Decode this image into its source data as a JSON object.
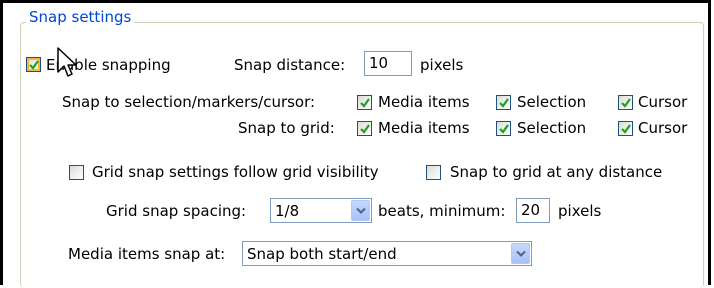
{
  "group": {
    "title": "Snap settings"
  },
  "enable_snapping": {
    "label": "Enable snapping",
    "checked": true
  },
  "snap_distance": {
    "label": "Snap distance:",
    "value": "10",
    "unit": "pixels"
  },
  "snap_to_selection": {
    "label": "Snap to selection/markers/cursor:",
    "options": [
      {
        "label": "Media items",
        "checked": true
      },
      {
        "label": "Selection",
        "checked": true
      },
      {
        "label": "Cursor",
        "checked": true
      }
    ]
  },
  "snap_to_grid": {
    "label": "Snap to grid:",
    "options": [
      {
        "label": "Media items",
        "checked": true
      },
      {
        "label": "Selection",
        "checked": true
      },
      {
        "label": "Cursor",
        "checked": true
      }
    ]
  },
  "grid_follow_visibility": {
    "label": "Grid snap settings follow grid visibility",
    "checked": false
  },
  "grid_any_distance": {
    "label": "Snap to grid at any distance",
    "checked": false
  },
  "grid_spacing": {
    "label": "Grid snap spacing:",
    "value": "1/8",
    "suffix": "beats, minimum:",
    "minimum": "20",
    "unit": "pixels"
  },
  "media_snap": {
    "label": "Media items snap at:",
    "value": "Snap both start/end"
  },
  "colors": {
    "title": "#0046d5",
    "check": "#21a121",
    "border": "#1c5180",
    "hover": "#f8b636"
  },
  "icons": {
    "check": "checkmark-icon",
    "dropdown": "chevron-down-icon",
    "cursor": "mouse-pointer-icon"
  }
}
